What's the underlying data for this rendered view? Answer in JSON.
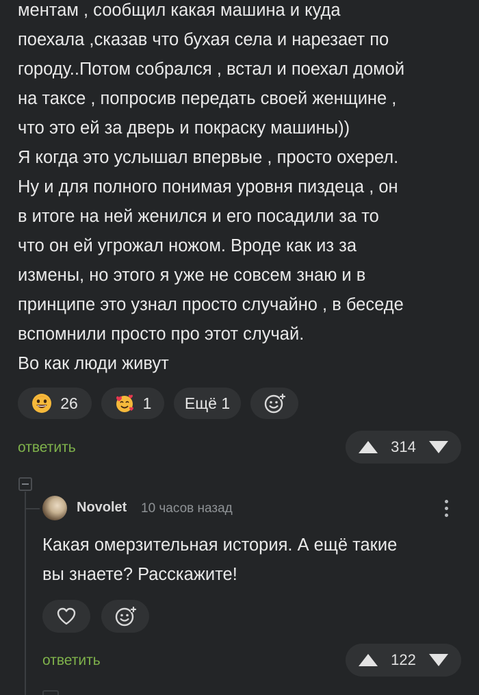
{
  "post": {
    "body_lines": [
      "ментам , сообщил какая машина и куда",
      "поехала ,сказав что бухая села и нарезает по",
      "городу..Потом собрался , встал и поехал домой",
      "на таксе , попросив передать своей женщине ,",
      "что это ей за дверь и покраску машины))",
      "Я когда это услышал впервые , просто охерел.",
      "Ну и для полного понимая уровня пиздеца , он",
      "в итоге на ней женился и его посадили за то",
      "что он ей угрожал ножом. Вроде как из за",
      "измены, но этого я уже не совсем знаю и в",
      "принципе это узнал просто случайно , в беседе",
      "вспомнили просто про этот случай.",
      "Во как люди живут"
    ],
    "reactions": [
      {
        "icon": "grinning-face-icon",
        "count": "26"
      },
      {
        "icon": "smiling-face-with-hearts-icon",
        "count": "1"
      }
    ],
    "more_reactions_label": "Ещё 1",
    "add_reaction_icon": "add-emoji-icon",
    "reply_label": "ответить",
    "rating": "314"
  },
  "reply": {
    "author": "Novolet",
    "timestamp": "10 часов назад",
    "text_lines": [
      "Какая омерзительная история. А ещё такие",
      "вы знаете? Расскажите!"
    ],
    "reply_label": "ответить",
    "rating": "122"
  },
  "colors": {
    "background": "#232527",
    "accent_green": "#7fb24b",
    "button_bg": "#303234",
    "text": "#e9e9e9",
    "muted": "#8f9396"
  }
}
